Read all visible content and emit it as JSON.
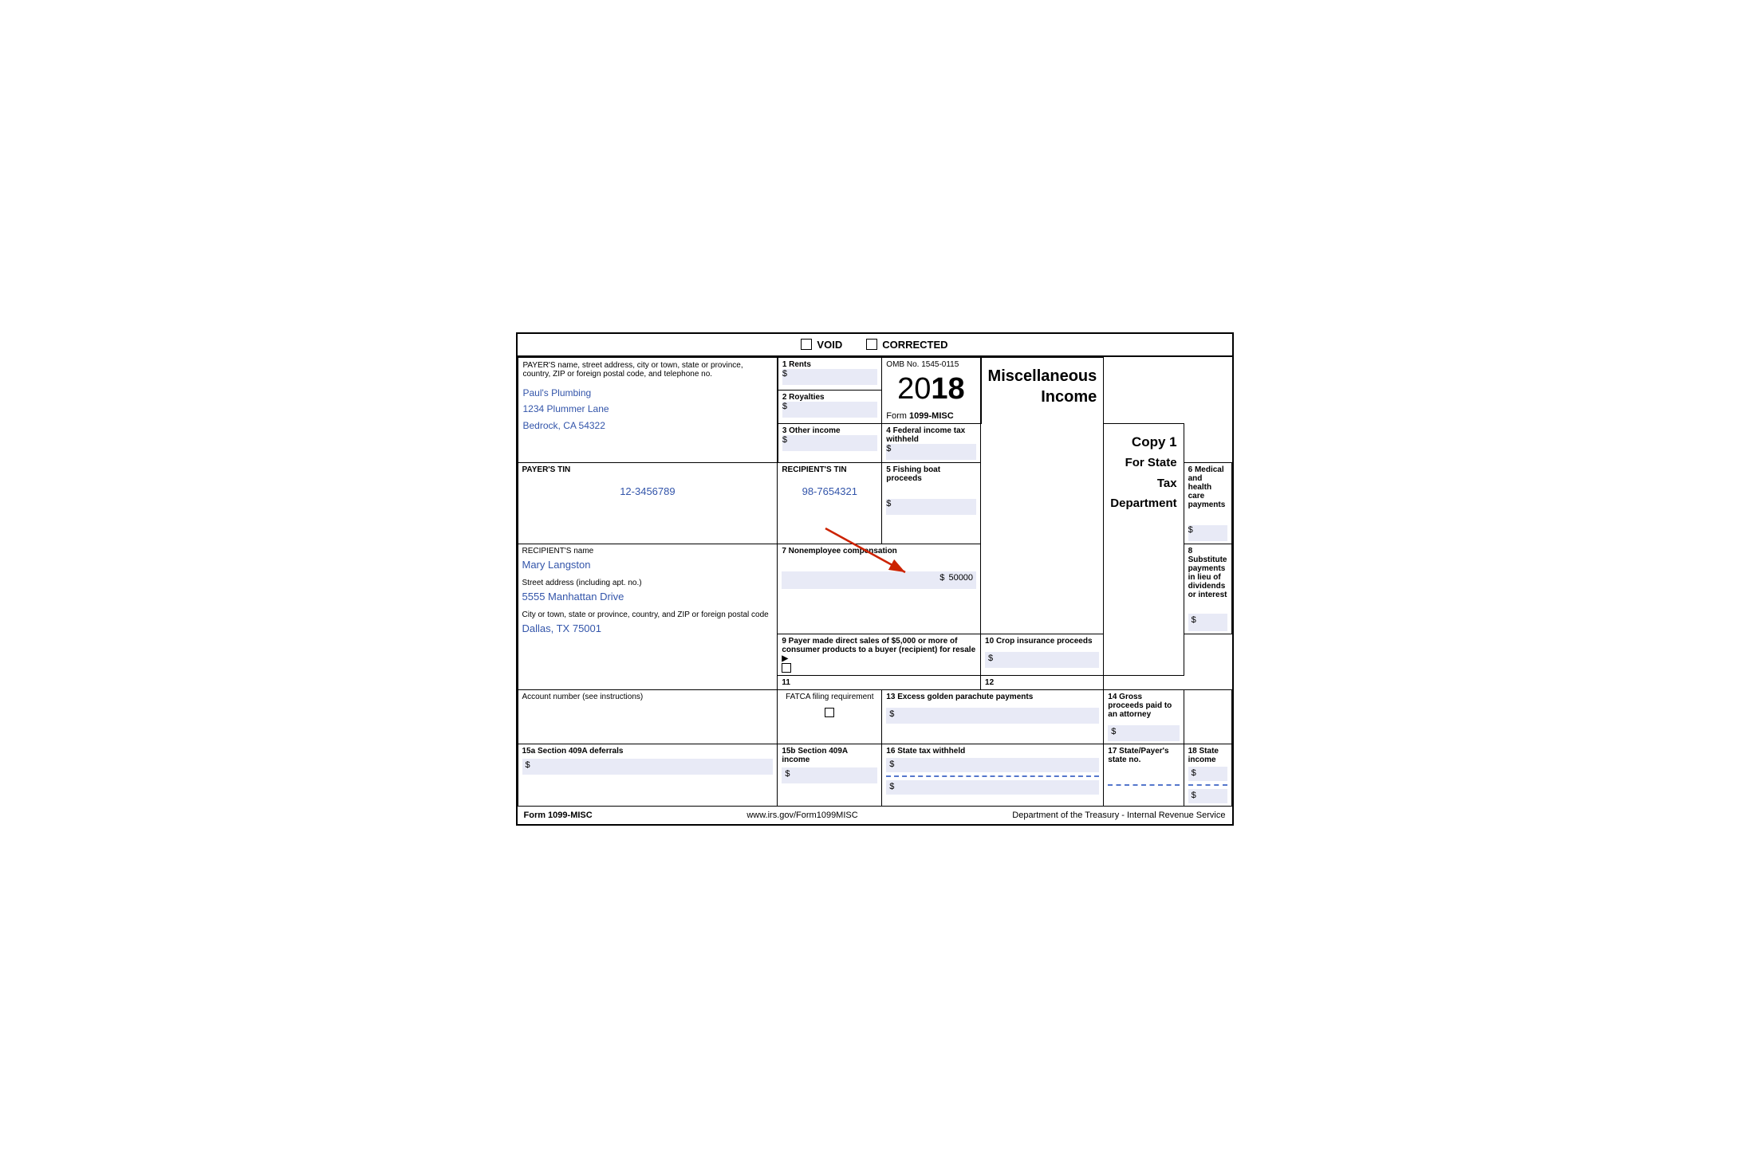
{
  "header": {
    "void_label": "VOID",
    "corrected_label": "CORRECTED"
  },
  "payer": {
    "label": "PAYER'S name, street address, city or town, state or province, country, ZIP or foreign postal code, and telephone no.",
    "name": "Paul's Plumbing",
    "address": "1234 Plummer Lane",
    "city_state": "Bedrock, CA 54322"
  },
  "fields": {
    "f1_label": "1 Rents",
    "f1_value": "",
    "f2_label": "2 Royalties",
    "f2_value": "",
    "f3_label": "3 Other income",
    "f3_value": "",
    "f4_label": "4 Federal income tax withheld",
    "f4_value": "",
    "f5_label": "5 Fishing boat proceeds",
    "f5_value": "",
    "f6_label": "6 Medical and health care payments",
    "f6_value": "",
    "f7_label": "7 Nonemployee compensation",
    "f7_value": "50000",
    "f8_label": "8 Substitute payments in lieu of dividends or interest",
    "f8_value": "",
    "f9_label": "9 Payer made direct sales of $5,000 or more of consumer products to a buyer (recipient) for resale ▶",
    "f10_label": "10 Crop insurance proceeds",
    "f10_value": "",
    "f11_label": "11",
    "f11_value": "",
    "f12_label": "12",
    "f12_value": "",
    "f13_label": "13 Excess golden parachute payments",
    "f13_value": "",
    "f14_label": "14 Gross proceeds paid to an attorney",
    "f14_value": "",
    "f15a_label": "15a Section 409A deferrals",
    "f15a_value": "",
    "f15b_label": "15b Section 409A income",
    "f15b_value": "",
    "f16_label": "16 State tax withheld",
    "f16_value": "",
    "f17_label": "17 State/Payer's state no.",
    "f17_value": "",
    "f18_label": "18 State income",
    "f18_value": ""
  },
  "omb": {
    "label": "OMB No. 1545-0115",
    "year": "2018",
    "year_prefix": "20",
    "year_suffix": "18"
  },
  "title": {
    "main": "Miscellaneous",
    "sub": "Income"
  },
  "copy_label": "Copy 1",
  "copy_sublabel": "For State Tax Department",
  "form_label": "Form 1099-MISC",
  "payer_tin_label": "PAYER'S TIN",
  "payer_tin_value": "12-3456789",
  "recipient_tin_label": "RECIPIENT'S TIN",
  "recipient_tin_value": "98-7654321",
  "recipient": {
    "name_label": "RECIPIENT'S name",
    "name_value": "Mary Langston",
    "street_label": "Street address (including apt. no.)",
    "street_value": "5555 Manhattan Drive",
    "city_label": "City or town, state or province, country, and ZIP or foreign postal code",
    "city_value": "Dallas, TX 75001"
  },
  "account": {
    "label": "Account number (see instructions)",
    "fatca_label": "FATCA filing requirement",
    "value": ""
  },
  "footer": {
    "form_label": "Form 1099-MISC",
    "website": "www.irs.gov/Form1099MISC",
    "dept": "Department of the Treasury - Internal Revenue Service"
  }
}
